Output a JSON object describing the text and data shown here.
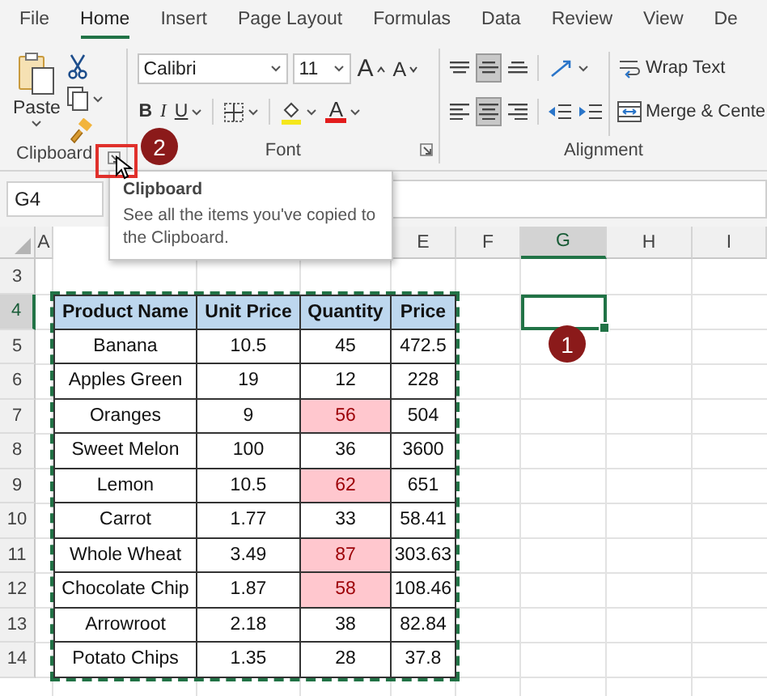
{
  "ribbon_tabs": [
    {
      "label": "File",
      "selected": false
    },
    {
      "label": "Home",
      "selected": true
    },
    {
      "label": "Insert",
      "selected": false
    },
    {
      "label": "Page Layout",
      "selected": false
    },
    {
      "label": "Formulas",
      "selected": false
    },
    {
      "label": "Data",
      "selected": false
    },
    {
      "label": "Review",
      "selected": false
    },
    {
      "label": "View",
      "selected": false
    },
    {
      "label": "De",
      "selected": false
    }
  ],
  "ribbon": {
    "clipboard": {
      "paste_label": "Paste",
      "group_label": "Clipboard"
    },
    "font": {
      "font_name": "Calibri",
      "font_size": "11",
      "size_buttons": [
        {
          "kind": "grow",
          "label": "A"
        },
        {
          "kind": "shrink",
          "label": "A"
        }
      ],
      "style_buttons": [
        {
          "kind": "bold",
          "label": "B"
        },
        {
          "kind": "italic",
          "label": "I"
        },
        {
          "kind": "underline",
          "label": "U"
        }
      ],
      "font_color_label": "A",
      "group_label": "Font"
    },
    "alignment": {
      "vertical_align": [
        {
          "kind": "top",
          "selected": false
        },
        {
          "kind": "middle",
          "selected": true
        },
        {
          "kind": "bottom",
          "selected": false
        }
      ],
      "horizontal_align": [
        {
          "kind": "left",
          "selected": false
        },
        {
          "kind": "center",
          "selected": true
        },
        {
          "kind": "right",
          "selected": false
        }
      ],
      "wrap_text": "Wrap Text",
      "merge": "Merge & Cente",
      "group_label": "Alignment"
    }
  },
  "name_box": "G4",
  "tooltip": {
    "title": "Clipboard",
    "text": "See all the items you've copied to the Clipboard."
  },
  "column_headers": [
    {
      "label": "A",
      "selected": false
    },
    {
      "label": "E",
      "selected": false
    },
    {
      "label": "F",
      "selected": false
    },
    {
      "label": "G",
      "selected": true
    },
    {
      "label": "H",
      "selected": false
    },
    {
      "label": "I",
      "selected": false
    }
  ],
  "row_headers": [
    {
      "label": "3",
      "selected": false
    },
    {
      "label": "4",
      "selected": true
    },
    {
      "label": "5",
      "selected": false
    },
    {
      "label": "6",
      "selected": false
    },
    {
      "label": "7",
      "selected": false
    },
    {
      "label": "8",
      "selected": false
    },
    {
      "label": "9",
      "selected": false
    },
    {
      "label": "10",
      "selected": false
    },
    {
      "label": "11",
      "selected": false
    },
    {
      "label": "12",
      "selected": false
    },
    {
      "label": "13",
      "selected": false
    },
    {
      "label": "14",
      "selected": false
    }
  ],
  "table": {
    "columns": [
      "Product Name",
      "Unit Price",
      "Quantity",
      "Price"
    ],
    "rows": [
      {
        "cells": [
          "Banana",
          "10.5",
          "45",
          "472.5"
        ],
        "quantity_highlighted": false
      },
      {
        "cells": [
          "Apples Green",
          "19",
          "12",
          "228"
        ],
        "quantity_highlighted": false
      },
      {
        "cells": [
          "Oranges",
          "9",
          "56",
          "504"
        ],
        "quantity_highlighted": true
      },
      {
        "cells": [
          "Sweet Melon",
          "100",
          "36",
          "3600"
        ],
        "quantity_highlighted": false
      },
      {
        "cells": [
          "Lemon",
          "10.5",
          "62",
          "651"
        ],
        "quantity_highlighted": true
      },
      {
        "cells": [
          "Carrot",
          "1.77",
          "33",
          "58.41"
        ],
        "quantity_highlighted": false
      },
      {
        "cells": [
          "Whole Wheat",
          "3.49",
          "87",
          "303.63"
        ],
        "quantity_highlighted": true
      },
      {
        "cells": [
          "Chocolate Chip",
          "1.87",
          "58",
          "108.46"
        ],
        "quantity_highlighted": true
      },
      {
        "cells": [
          "Arrowroot",
          "2.18",
          "38",
          "82.84"
        ],
        "quantity_highlighted": false
      },
      {
        "cells": [
          "Potato Chips",
          "1.35",
          "28",
          "37.8"
        ],
        "quantity_highlighted": false
      }
    ]
  },
  "callouts": [
    "2",
    "1"
  ]
}
